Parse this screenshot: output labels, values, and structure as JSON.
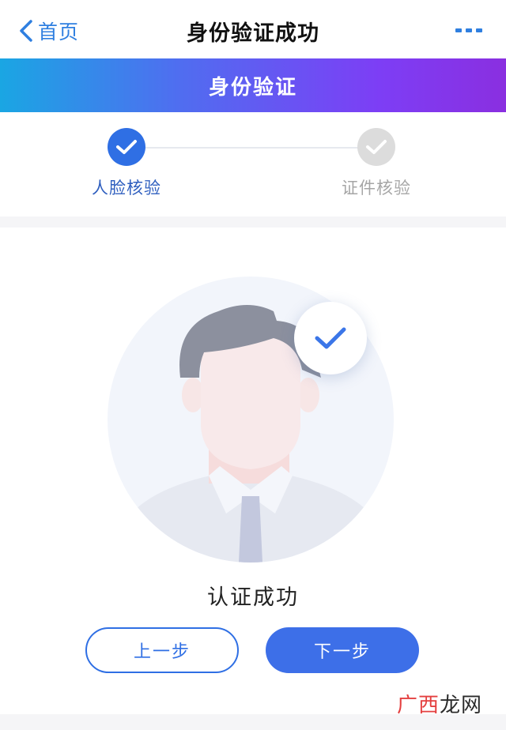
{
  "navbar": {
    "back_label": "首页",
    "title": "身份验证成功",
    "back_icon": "chevron-left-icon",
    "more_icon": "more-dots-icon"
  },
  "banner": {
    "title": "身份验证"
  },
  "steps": [
    {
      "label": "人脸核验",
      "status": "done",
      "color": "#2f6fe4"
    },
    {
      "label": "证件核验",
      "status": "pending",
      "color": "#dcdcdc"
    }
  ],
  "result": {
    "text": "认证成功",
    "check_icon": "check-icon"
  },
  "buttons": {
    "prev_label": "上一步",
    "next_label": "下一步"
  },
  "watermark": {
    "part1": "广西",
    "part2": "龙网"
  },
  "colors": {
    "accent": "#2f6fe4",
    "link": "#2f7fe0",
    "gradient_start": "#1aa6e3",
    "gradient_end": "#8a2fe0"
  }
}
